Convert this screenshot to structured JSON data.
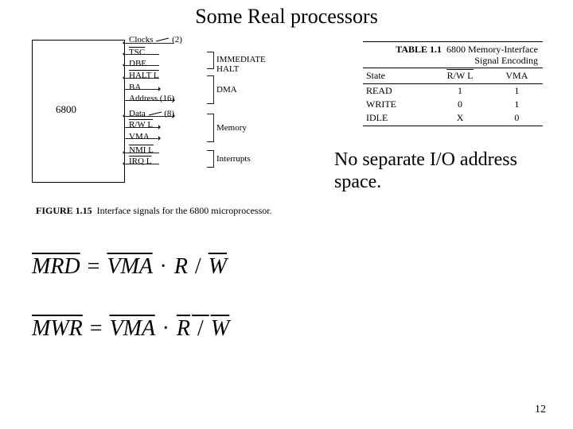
{
  "title": "Some Real processors",
  "chip": "6800",
  "signals": {
    "clocks": "Clocks",
    "clocks_n": "(2)",
    "tsc": "TSC",
    "dbe": "DBE",
    "haltL": "HALT L",
    "ba": "BA",
    "addr": "Address (16)",
    "data": "Data",
    "data_n": "(8)",
    "rwL": "R/W L",
    "vma": "VMA",
    "nmiL": "NMI L",
    "irqL": "IRQ L"
  },
  "groups": {
    "imm": "IMMEDIATE HALT",
    "dma": "DMA",
    "mem": "Memory",
    "int": "Interrupts"
  },
  "caption": {
    "fig": "FIGURE 1.15",
    "txt": "Interface signals for the 6800 microprocessor."
  },
  "table": {
    "num": "TABLE 1.1",
    "title1": "6800 Memory-Interface",
    "title2": "Signal Encoding",
    "head": {
      "c1": "State",
      "c2": "R/W L",
      "c3": "VMA"
    },
    "rows": [
      {
        "c1": "READ",
        "c2": "1",
        "c3": "1"
      },
      {
        "c1": "WRITE",
        "c2": "0",
        "c3": "1"
      },
      {
        "c1": "IDLE",
        "c2": "X",
        "c3": "0"
      }
    ]
  },
  "note": "No separate I/O address space.",
  "eq1": {
    "lhs": "MRD",
    "vma": "VMA",
    "dot": "·",
    "r": "R",
    "slash": " / ",
    "w": "W"
  },
  "eq2": {
    "lhs": "MWR",
    "vma": "VMA",
    "dot": "·",
    "r": "R",
    "slash": " / ",
    "w": "W"
  },
  "page": "12"
}
